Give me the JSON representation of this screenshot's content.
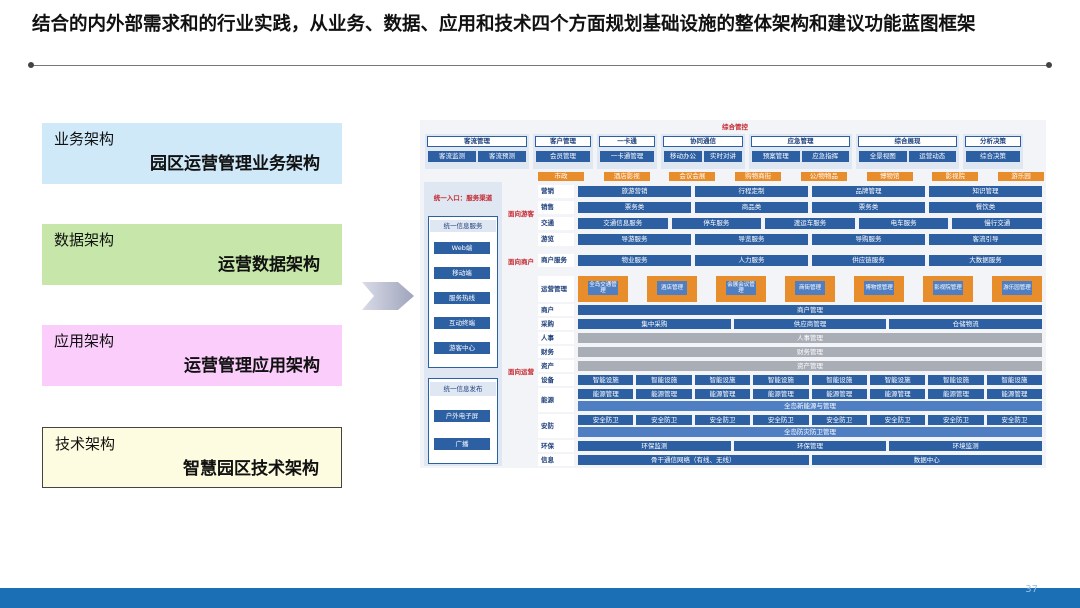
{
  "title": "结合的内外部需求和的行业实践，从业务、数据、应用和技术四个方面规划基础设施的整体架构和建议功能蓝图框架",
  "page_number": "37",
  "colors": {
    "business": "#cfe9f9",
    "data": "#c6e7a9",
    "application": "#fbcdfb",
    "technology": "#fefce0",
    "footer": "#1b6fb4",
    "diagram_blue": "#2d5fa3",
    "diagram_orange": "#e88d2c",
    "diagram_title_red": "#c4262e"
  },
  "architecture": [
    {
      "category": "业务架构",
      "name": "园区运营管理业务架构"
    },
    {
      "category": "数据架构",
      "name": "运营数据架构"
    },
    {
      "category": "应用架构",
      "name": "运营管理应用架构"
    },
    {
      "category": "技术架构",
      "name": "智慧园区技术架构"
    }
  ],
  "diagram": {
    "title": "综合管控",
    "top_groups": [
      {
        "header": "客流管理",
        "items": [
          "客流监测",
          "客流预测"
        ]
      },
      {
        "header": "客户管理",
        "items": [
          "会员管理"
        ]
      },
      {
        "header": "一卡通",
        "items": [
          "一卡通管理"
        ]
      },
      {
        "header": "协同通信",
        "items": [
          "移动办公",
          "实时对讲"
        ]
      },
      {
        "header": "应急管理",
        "items": [
          "预案管理",
          "应急指挥"
        ]
      },
      {
        "header": "综合展现",
        "items": [
          "全景视图",
          "运营动态"
        ]
      },
      {
        "header": "分析决策",
        "items": [
          "综合决策"
        ]
      }
    ],
    "left_panel": {
      "entry_title": "统一入口：服务渠道",
      "service_title": "统一信息服务",
      "service_items": [
        "Web端",
        "移动端",
        "服务热线",
        "互动终端",
        "游客中心"
      ],
      "publish_title": "统一信息发布",
      "publish_items": [
        "户外电子屏",
        "广播"
      ]
    },
    "section_tourist": "面向游客",
    "section_merchant": "面向商户",
    "section_ops": "面向运营",
    "top_tabs": [
      "市政",
      "酒店影视",
      "会议会展",
      "购物商街",
      "公/物物品",
      "博物馆",
      "影视院",
      "游乐园"
    ],
    "tourist_rows": [
      {
        "label": "营销",
        "items": [
          "旅游营销",
          "行程定制",
          "品牌管理",
          "知识管理"
        ]
      },
      {
        "label": "销售",
        "items": [
          "票务类",
          "商品类",
          "票务类",
          "餐饮类"
        ]
      },
      {
        "label": "交通",
        "items": [
          "交通信息服务",
          "停车服务",
          "渡运车服务",
          "电车服务",
          "慢行交通"
        ]
      },
      {
        "label": "游览",
        "items": [
          "导游服务",
          "导览服务",
          "导购服务",
          "客流引导"
        ]
      }
    ],
    "merchant_row": {
      "label": "商户服务",
      "items": [
        "物业服务",
        "人力服务",
        "供应链服务",
        "大数据服务"
      ]
    },
    "ops_orange": [
      "全岛交通管理",
      "酒店管理",
      "会展会议管理",
      "商街管理",
      "博物馆管理",
      "影视院管理",
      "游乐园管理"
    ],
    "ops_rows": [
      {
        "label": "运营管理"
      },
      {
        "label": "商户",
        "items": [
          "商户管理"
        ]
      },
      {
        "label": "采购",
        "items": [
          "集中采购",
          "供应商管理",
          "仓储物流"
        ]
      },
      {
        "label": "人事",
        "items": [
          "人事管理"
        ]
      },
      {
        "label": "财务",
        "items": [
          "财务管理"
        ]
      },
      {
        "label": "资产",
        "items": [
          "资产管理"
        ]
      },
      {
        "label": "设备",
        "items": [
          "智能设施",
          "智能设施",
          "智能设施",
          "智能设施",
          "智能设施",
          "智能设施",
          "智能设施",
          "智能设施"
        ]
      },
      {
        "label": "能源",
        "items": [
          "能源管理",
          "能源管理",
          "能源管理",
          "能源管理",
          "能源管理",
          "能源管理",
          "能源管理",
          "能源管理"
        ],
        "sub": "全岛新能源与管理"
      },
      {
        "label": "安防",
        "items": [
          "安全防卫",
          "安全防卫",
          "安全防卫",
          "安全防卫",
          "安全防卫",
          "安全防卫",
          "安全防卫",
          "安全防卫"
        ],
        "sub": "全岛防灾防卫管理"
      },
      {
        "label": "环保",
        "items": [
          "环保监测",
          "环保管理",
          "环境监测"
        ]
      },
      {
        "label": "信息",
        "items": [
          "骨干通信网络（有线、无线）",
          "数据中心"
        ]
      }
    ]
  }
}
